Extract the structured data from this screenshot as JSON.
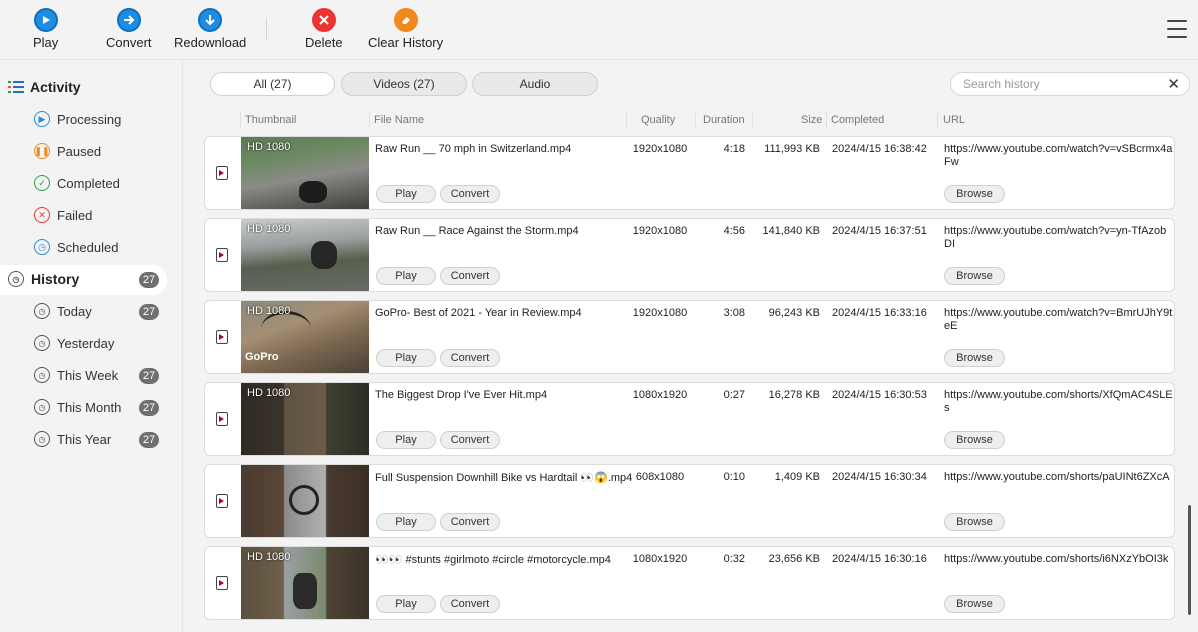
{
  "toolbar": {
    "play": "Play",
    "convert": "Convert",
    "redownload": "Redownload",
    "delete": "Delete",
    "clear_history": "Clear History"
  },
  "sidebar": {
    "activity": "Activity",
    "processing": "Processing",
    "paused": "Paused",
    "completed": "Completed",
    "failed": "Failed",
    "scheduled": "Scheduled",
    "history": "History",
    "history_count": "27",
    "today": "Today",
    "today_count": "27",
    "yesterday": "Yesterday",
    "this_week": "This Week",
    "this_week_count": "27",
    "this_month": "This Month",
    "this_month_count": "27",
    "this_year": "This Year",
    "this_year_count": "27"
  },
  "tabs": {
    "all": "All (27)",
    "videos": "Videos (27)",
    "audio": "Audio"
  },
  "search": {
    "placeholder": "Search history"
  },
  "columns": {
    "thumbnail": "Thumbnail",
    "file_name": "File Name",
    "quality": "Quality",
    "duration": "Duration",
    "size": "Size",
    "completed": "Completed",
    "url": "URL"
  },
  "row_buttons": {
    "play": "Play",
    "convert": "Convert",
    "browse": "Browse"
  },
  "rows": [
    {
      "badge": "HD 1080",
      "name": "Raw Run __ 70 mph in Switzerland.mp4",
      "quality": "1920x1080",
      "duration": "4:18",
      "size": "111,993 KB",
      "completed": "2024/4/15 16:38:42",
      "url": "https://www.youtube.com/watch?v=vSBcrmx4aFw"
    },
    {
      "badge": "HD 1080",
      "name": "Raw Run __ Race Against the Storm.mp4",
      "quality": "1920x1080",
      "duration": "4:56",
      "size": "141,840 KB",
      "completed": "2024/4/15 16:37:51",
      "url": "https://www.youtube.com/watch?v=yn-TfAzobDI"
    },
    {
      "badge": "HD 1080",
      "name": "GoPro- Best of 2021 - Year in Review.mp4",
      "quality": "1920x1080",
      "duration": "3:08",
      "size": "96,243 KB",
      "completed": "2024/4/15 16:33:16",
      "url": "https://www.youtube.com/watch?v=BmrUJhY9teE",
      "watermark": "GoPro"
    },
    {
      "badge": "HD 1080",
      "name": "The Biggest Drop I've Ever Hit.mp4",
      "quality": "1080x1920",
      "duration": "0:27",
      "size": "16,278 KB",
      "completed": "2024/4/15 16:30:53",
      "url": "https://www.youtube.com/shorts/XfQmAC4SLEs"
    },
    {
      "badge": "",
      "name": "Full Suspension Downhill Bike vs Hardtail 👀😱.mp4",
      "quality": "608x1080",
      "duration": "0:10",
      "size": "1,409 KB",
      "completed": "2024/4/15 16:30:34",
      "url": "https://www.youtube.com/shorts/paUINt6ZXcA"
    },
    {
      "badge": "HD 1080",
      "name": "👀👀 #stunts #girlmoto #circle #motorcycle.mp4",
      "quality": "1080x1920",
      "duration": "0:32",
      "size": "23,656 KB",
      "completed": "2024/4/15 16:30:16",
      "url": "https://www.youtube.com/shorts/i6NXzYbOI3k"
    }
  ]
}
